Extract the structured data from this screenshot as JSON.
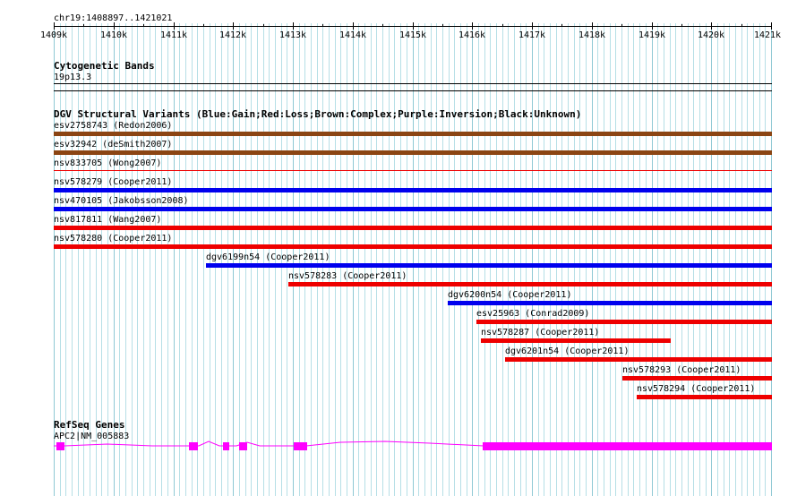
{
  "ruler": {
    "range_label": "chr19:1408897..1421021",
    "ticks": [
      "1409k",
      "1410k",
      "1411k",
      "1412k",
      "1413k",
      "1414k",
      "1415k",
      "1416k",
      "1417k",
      "1418k",
      "1419k",
      "1420k",
      "1421k"
    ]
  },
  "tracks": {
    "cytogenetic": {
      "title": "Cytogenetic Bands",
      "band": "19p13.3"
    },
    "dgv": {
      "title": "DGV Structural Variants (Blue:Gain;Red:Loss;Brown:Complex;Purple:Inversion;Black:Unknown)",
      "features": [
        {
          "label": "esv2758743 (Redon2006)",
          "type": "complex",
          "color": "#8b4513"
        },
        {
          "label": "esv32942 (deSmith2007)",
          "type": "complex",
          "color": "#8b4513"
        },
        {
          "label": "nsv833705 (Wong2007)",
          "type": "loss",
          "color": "#ee0000"
        },
        {
          "label": "nsv578279 (Cooper2011)",
          "type": "gain",
          "color": "#0000ee"
        },
        {
          "label": "nsv470105 (Jakobsson2008)",
          "type": "gain",
          "color": "#0000ee"
        },
        {
          "label": "nsv817811 (Wang2007)",
          "type": "loss",
          "color": "#ee0000"
        },
        {
          "label": "nsv578280 (Cooper2011)",
          "type": "loss",
          "color": "#ee0000"
        },
        {
          "label": "dgv6199n54 (Cooper2011)",
          "type": "gain",
          "color": "#0000ee"
        },
        {
          "label": "nsv578283 (Cooper2011)",
          "type": "loss",
          "color": "#ee0000"
        },
        {
          "label": "dgv6200n54 (Cooper2011)",
          "type": "gain",
          "color": "#0000ee"
        },
        {
          "label": "esv25963 (Conrad2009)",
          "type": "loss",
          "color": "#ee0000"
        },
        {
          "label": "nsv578287 (Cooper2011)",
          "type": "loss",
          "color": "#ee0000"
        },
        {
          "label": "dgv6201n54 (Cooper2011)",
          "type": "loss",
          "color": "#ee0000"
        },
        {
          "label": "nsv578293 (Cooper2011)",
          "type": "loss",
          "color": "#ee0000"
        },
        {
          "label": "nsv578294 (Cooper2011)",
          "type": "loss",
          "color": "#ee0000"
        }
      ]
    },
    "refseq": {
      "title": "RefSeq Genes",
      "gene_label": "APC2|NM_005883",
      "color": "#ff00ff"
    }
  }
}
